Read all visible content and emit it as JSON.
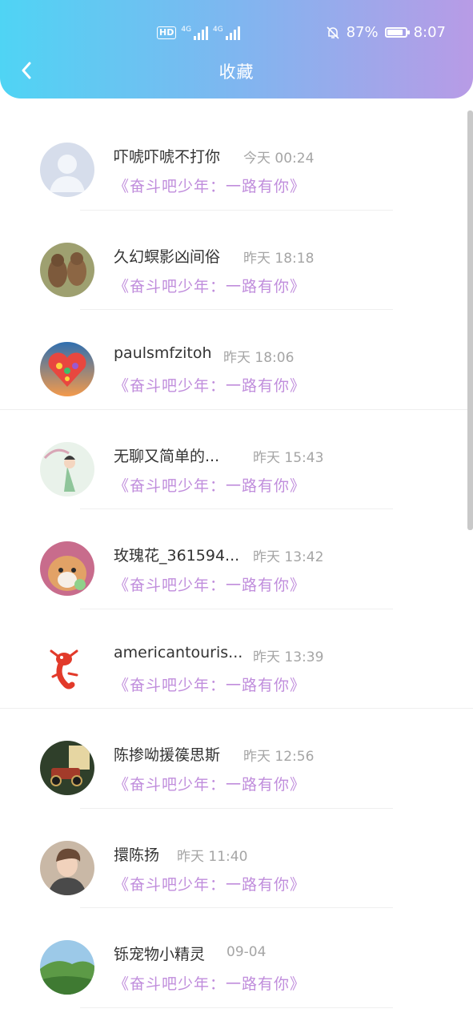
{
  "status_bar": {
    "hd": "HD",
    "network1": "4G",
    "network2": "4G",
    "battery_percent": "87%",
    "battery_level": 0.87,
    "time": "8:07"
  },
  "header": {
    "title": "收藏"
  },
  "items": [
    {
      "name": "吓唬吓唬不打你",
      "time": "今天 00:24",
      "show": "《奋斗吧少年：一路有你》"
    },
    {
      "name": "久幻螟影凶间俗",
      "time": "昨天 18:18",
      "show": "《奋斗吧少年：一路有你》"
    },
    {
      "name": "paulsmfzitoh",
      "time": "昨天 18:06",
      "show": "《奋斗吧少年：一路有你》"
    },
    {
      "name": "无聊又简单的...",
      "time": "昨天 15:43",
      "show": "《奋斗吧少年：一路有你》"
    },
    {
      "name": "玫瑰花_361594...",
      "time": "昨天 13:42",
      "show": "《奋斗吧少年：一路有你》"
    },
    {
      "name": "americantouris...",
      "time": "昨天 13:39",
      "show": "《奋斗吧少年：一路有你》"
    },
    {
      "name": "陈掺呦援篌思斯",
      "time": "昨天 12:56",
      "show": "《奋斗吧少年：一路有你》"
    },
    {
      "name": "擐陈扬",
      "time": "昨天 11:40",
      "show": "《奋斗吧少年：一路有你》"
    },
    {
      "name": "铄宠物小精灵",
      "time": "09-04",
      "show": "《奋斗吧少年：一路有你》"
    }
  ]
}
